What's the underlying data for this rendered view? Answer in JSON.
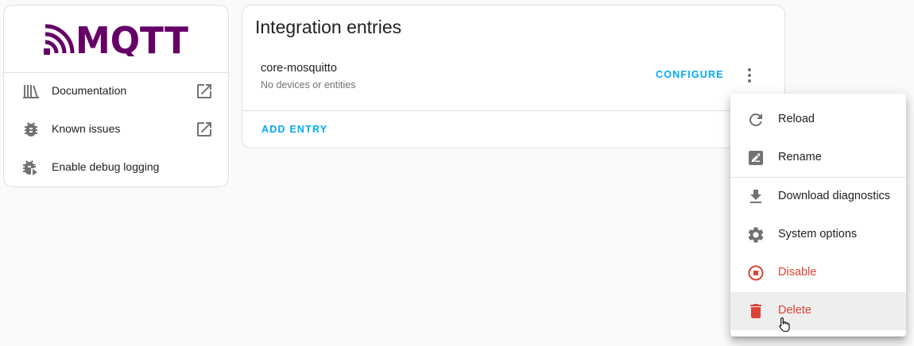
{
  "colors": {
    "accent": "#03a9f4",
    "brand": "#660066",
    "warning": "#db4437",
    "icon": "#727272"
  },
  "info_card": {
    "logo_text": "MQTT",
    "items": [
      {
        "label": "Documentation",
        "icon": "book-icon",
        "external": true
      },
      {
        "label": "Known issues",
        "icon": "bug-icon",
        "external": true
      },
      {
        "label": "Enable debug logging",
        "icon": "bug-play-icon",
        "external": false
      }
    ]
  },
  "entries": {
    "title": "Integration entries",
    "items": [
      {
        "name": "core-mosquitto",
        "subtitle": "No devices or entities",
        "configure_label": "CONFIGURE"
      }
    ],
    "add_entry_label": "ADD ENTRY"
  },
  "menu": {
    "items": [
      {
        "label": "Reload",
        "icon": "reload-icon"
      },
      {
        "label": "Rename",
        "icon": "rename-icon"
      },
      {
        "label": "Download diagnostics",
        "icon": "download-icon"
      },
      {
        "label": "System options",
        "icon": "gear-icon"
      },
      {
        "label": "Disable",
        "icon": "stop-circle-icon",
        "warning": true
      },
      {
        "label": "Delete",
        "icon": "trash-icon",
        "warning": true,
        "hovered": true
      }
    ]
  }
}
